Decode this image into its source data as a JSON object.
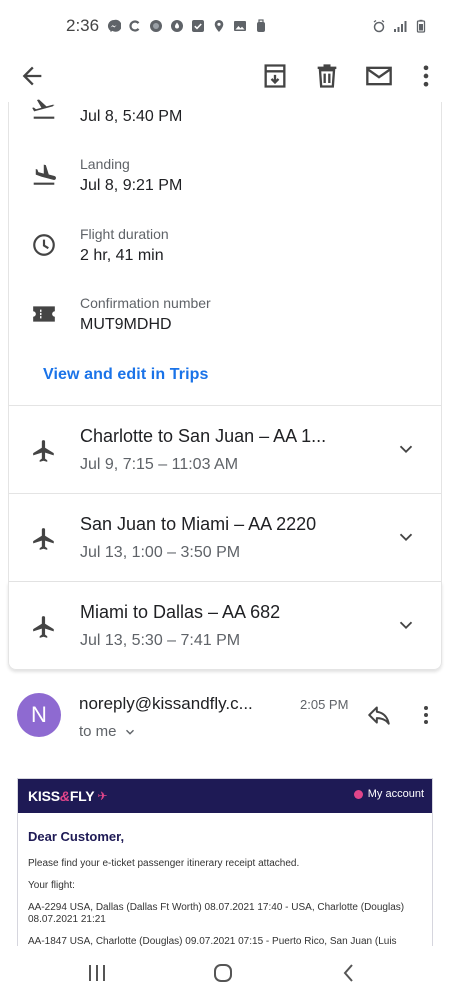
{
  "status_bar": {
    "time": "2:36"
  },
  "details": [
    {
      "label": "",
      "value": "Jul 8, 5:40 PM",
      "icon": "takeoff-icon"
    },
    {
      "label": "Landing",
      "value": "Jul 8, 9:21 PM",
      "icon": "landing-icon"
    },
    {
      "label": "Flight duration",
      "value": "2 hr, 41 min",
      "icon": "clock-icon"
    },
    {
      "label": "Confirmation number",
      "value": "MUT9MDHD",
      "icon": "ticket-icon"
    }
  ],
  "trips_link": "View and edit in Trips",
  "segments": [
    {
      "title": "Charlotte to San Juan – AA 1...",
      "time": "Jul 9, 7:15 – 11:03 AM"
    },
    {
      "title": "San Juan to Miami – AA 2220",
      "time": "Jul 13, 1:00 – 3:50 PM"
    },
    {
      "title": "Miami to Dallas – AA 682",
      "time": "Jul 13, 5:30 – 7:41 PM"
    }
  ],
  "email": {
    "avatar_letter": "N",
    "sender": "noreply@kissandfly.c...",
    "time": "2:05 PM",
    "to": "to me"
  },
  "mail_body": {
    "logo_kiss": "KISS",
    "logo_amp": "&",
    "logo_fly": "FLY",
    "account": "My account",
    "greeting": "Dear Customer,",
    "p1": "Please find your e-ticket passenger itinerary receipt attached.",
    "p2": "Your flight:",
    "p3": "AA-2294 USA, Dallas (Dallas Ft Worth) 08.07.2021 17:40 - USA, Charlotte (Douglas) 08.07.2021 21:21",
    "p4": "AA-1847 USA, Charlotte (Douglas) 09.07.2021 07:15 - Puerto Rico, San Juan (Luis"
  },
  "colors": {
    "accent": "#1a73e8",
    "avatar": "#8e6ad1",
    "mail_header": "#1e1a55",
    "brand_pink": "#e0458a"
  }
}
